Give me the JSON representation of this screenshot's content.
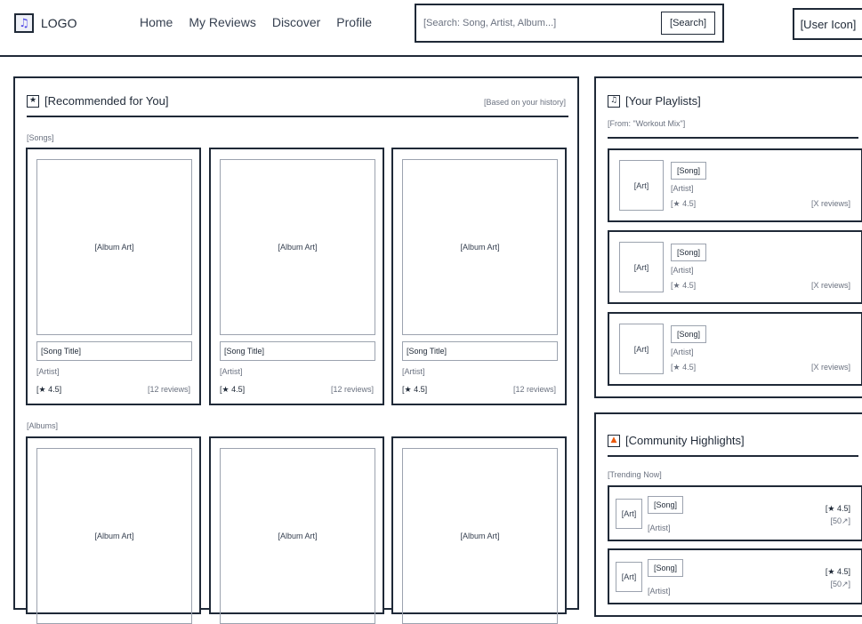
{
  "header": {
    "logo_text": "LOGO",
    "logo_icon": "music-note-icon",
    "nav": [
      "Home",
      "My Reviews",
      "Discover",
      "Profile"
    ],
    "search": {
      "placeholder": "[Search: Song, Artist, Album...]",
      "button": "[Search]"
    },
    "user_icon": "[User Icon]"
  },
  "recommended": {
    "icon": "star-icon",
    "title": "[Recommended for You]",
    "note": "[Based on your history]",
    "songs_label": "[Songs]",
    "songs": [
      {
        "art": "[Album Art]",
        "title": "[Song Title]",
        "artist": "[Artist]",
        "rating": "[★ 4.5]",
        "reviews": "[12 reviews]"
      },
      {
        "art": "[Album Art]",
        "title": "[Song Title]",
        "artist": "[Artist]",
        "rating": "[★ 4.5]",
        "reviews": "[12 reviews]"
      },
      {
        "art": "[Album Art]",
        "title": "[Song Title]",
        "artist": "[Artist]",
        "rating": "[★ 4.5]",
        "reviews": "[12 reviews]"
      }
    ],
    "albums_label": "[Albums]",
    "albums": [
      {
        "art": "[Album Art]"
      },
      {
        "art": "[Album Art]"
      },
      {
        "art": "[Album Art]"
      }
    ]
  },
  "playlists": {
    "icon": "playlist-icon",
    "title": "[Your Playlists]",
    "subtitle": "[From: \"Workout Mix\"]",
    "items": [
      {
        "art": "[Art]",
        "song": "[Song]",
        "artist": "[Artist]",
        "rating": "[★ 4.5]",
        "reviews": "[X reviews]"
      },
      {
        "art": "[Art]",
        "song": "[Song]",
        "artist": "[Artist]",
        "rating": "[★ 4.5]",
        "reviews": "[X reviews]"
      },
      {
        "art": "[Art]",
        "song": "[Song]",
        "artist": "[Artist]",
        "rating": "[★ 4.5]",
        "reviews": "[X reviews]"
      }
    ]
  },
  "community": {
    "icon": "fire-icon",
    "title": "[Community Highlights]",
    "subtitle": "[Trending Now]",
    "items": [
      {
        "art": "[Art]",
        "song": "[Song]",
        "artist": "[Artist]",
        "rating": "[★ 4.5]",
        "count": "[50↗]"
      },
      {
        "art": "[Art]",
        "song": "[Song]",
        "artist": "[Artist]",
        "rating": "[★ 4.5]",
        "count": "[50↗]"
      }
    ]
  },
  "colors": {
    "border": "#1f2937",
    "muted": "#6b7280",
    "art_border": "#9ca3af",
    "accent": "#4f46e5",
    "fire": "#ea580c"
  }
}
